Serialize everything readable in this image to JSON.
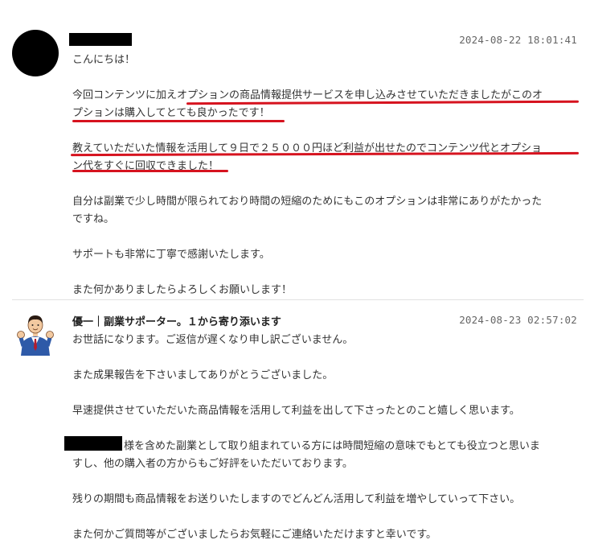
{
  "messages": [
    {
      "timestamp": "2024-08-22 18:01:41",
      "lines": {
        "greeting": "こんにちは！",
        "p1_l1": "今回コンテンツに加えオプションの商品情報提供サービスを申し込みさせていただきましたがこのオ",
        "p1_l2": "プションは購入してとても良かったです！",
        "p2_l1": "教えていただいた情報を活用して９日で２５０００円ほど利益が出せたのでコンテンツ代とオプショ",
        "p2_l2": "ン代をすぐに回収できました！",
        "p3_l1": "自分は副業で少し時間が限られており時間の短縮のためにもこのオプションは非常にありがたかった",
        "p3_l2": "ですね。",
        "p4": "サポートも非常に丁寧で感謝いたします。",
        "p5": "また何かありましたらよろしくお願いします！"
      }
    },
    {
      "sender": "優一｜副業サポーター。１から寄り添います",
      "timestamp": "2024-08-23 02:57:02",
      "lines": {
        "p1": "お世話になります。ご返信が遅くなり申し訳ございません。",
        "p2": "また成果報告を下さいましてありがとうございました。",
        "p3": "早速提供させていただいた商品情報を活用して利益を出して下さったとのこと嬉しく思います。",
        "p4_l1": "様を含めた副業として取り組まれている方には時間短縮の意味でもとても役立つと思いま",
        "p4_l2": "すし、他の購入者の方からもご好評をいただいております。",
        "p5": "残りの期間も商品情報をお送りいたしますのでどんどん活用して利益を増やしていって下さい。",
        "p6": "また何かご質問等がございましたらお気軽にご連絡いただけますと幸いです。"
      }
    }
  ],
  "colors": {
    "underline": "#d6131f",
    "text": "#333333",
    "timestamp": "#666666"
  },
  "icons": {
    "avatar_2": "businessman-avatar-icon"
  }
}
